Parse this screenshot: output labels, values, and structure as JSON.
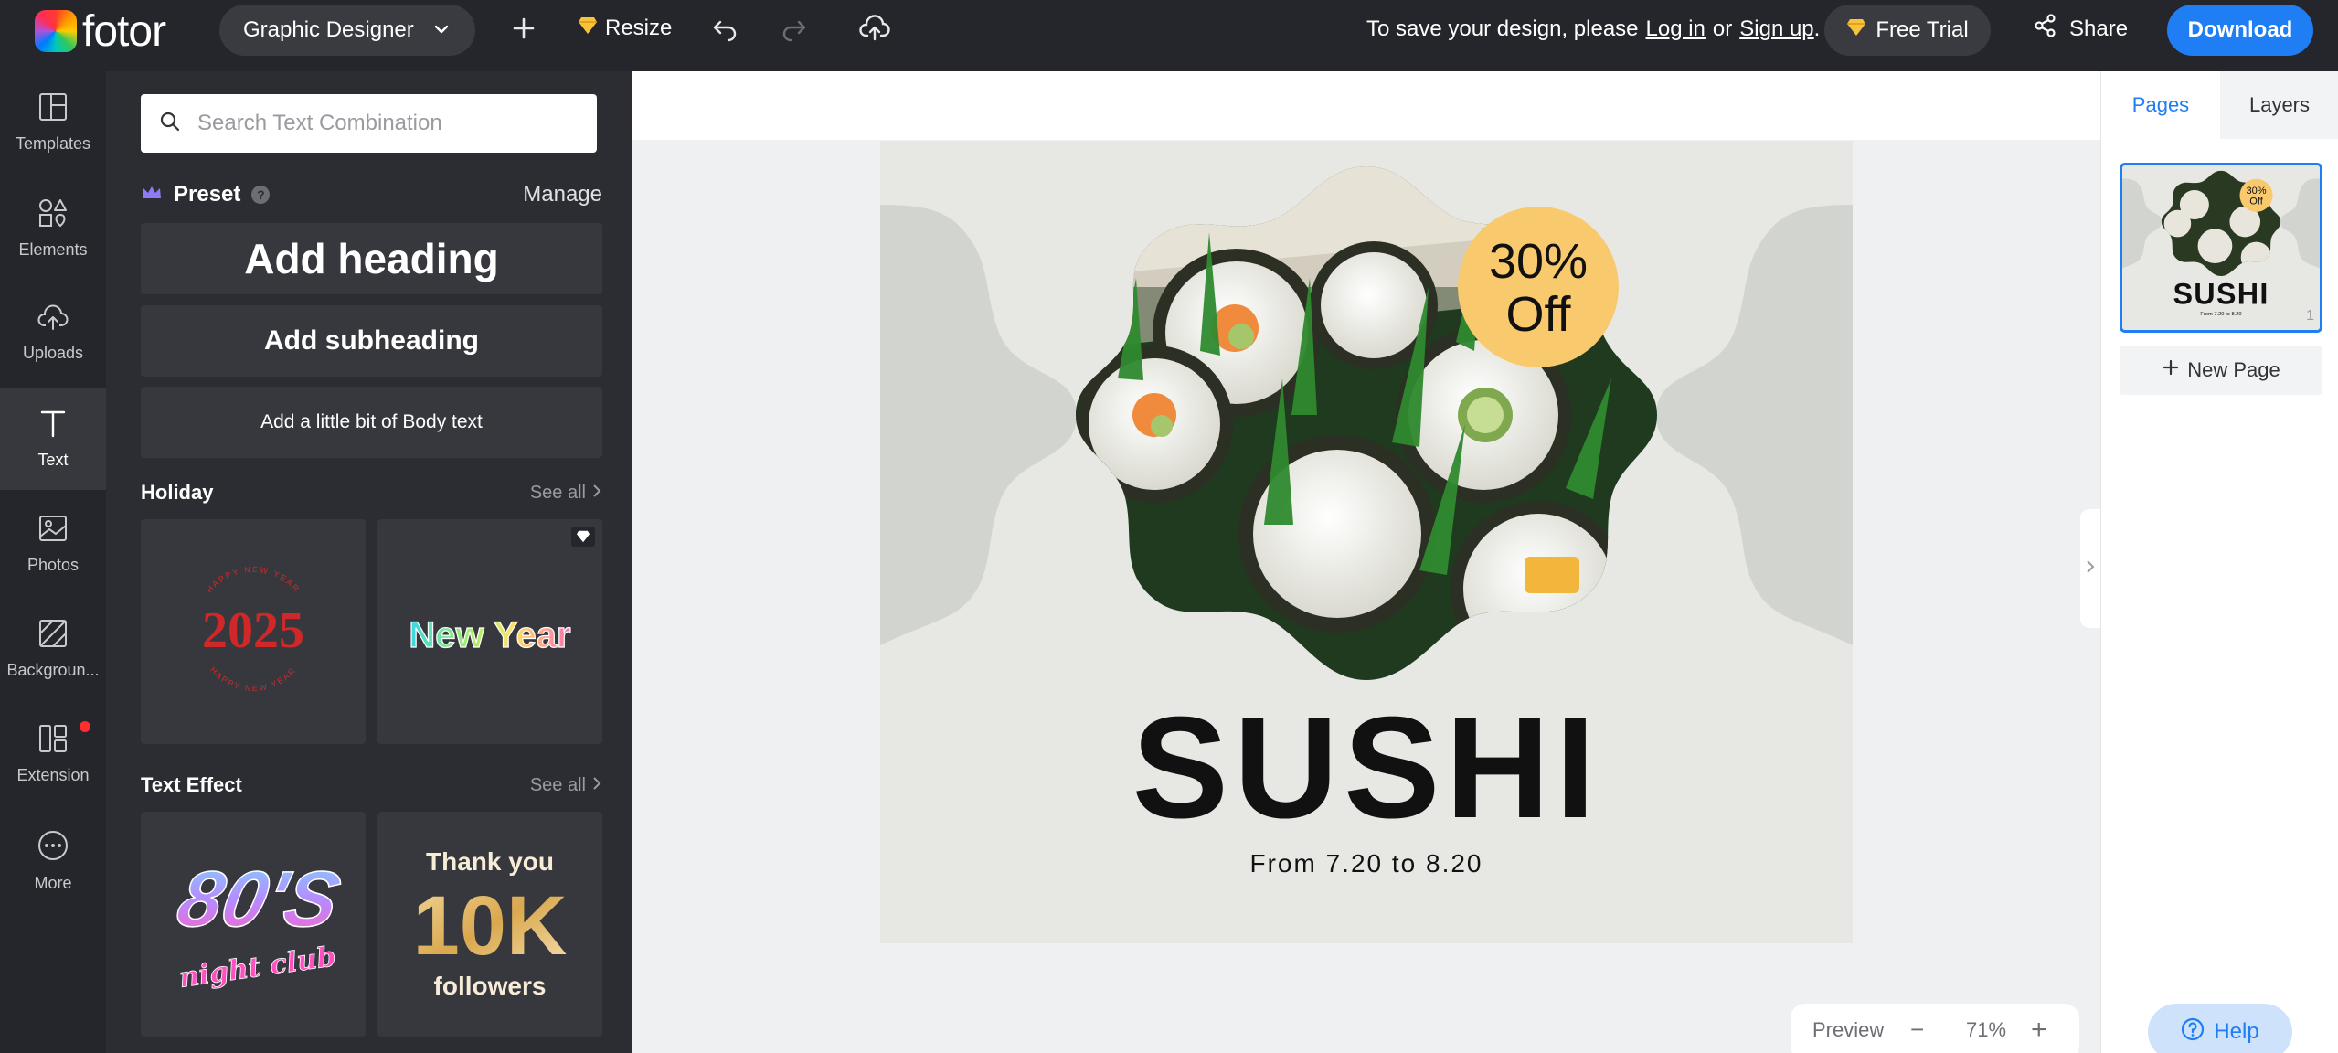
{
  "app": {
    "brand": "fotor"
  },
  "topbar": {
    "design_type": "Graphic Designer",
    "resize_label": "Resize",
    "save_prompt": "To save your design, please",
    "login_label": "Log in",
    "or_label": "or",
    "signup_label": "Sign up",
    "period": ".",
    "free_trial_label": "Free Trial",
    "share_label": "Share",
    "download_label": "Download"
  },
  "leftnav": {
    "items": [
      {
        "label": "Templates",
        "icon": "templates-icon"
      },
      {
        "label": "Elements",
        "icon": "elements-icon"
      },
      {
        "label": "Uploads",
        "icon": "uploads-icon"
      },
      {
        "label": "Text",
        "icon": "text-icon",
        "active": true
      },
      {
        "label": "Photos",
        "icon": "photos-icon"
      },
      {
        "label": "Backgroun...",
        "icon": "background-icon"
      },
      {
        "label": "Extension",
        "icon": "extension-icon",
        "badge": true
      },
      {
        "label": "More",
        "icon": "more-icon"
      }
    ]
  },
  "panel": {
    "search_placeholder": "Search Text Combination",
    "preset_title": "Preset",
    "manage_label": "Manage",
    "add_heading": "Add heading",
    "add_subheading": "Add subheading",
    "add_body": "Add a little bit of Body text",
    "holiday": {
      "title": "Holiday",
      "see_all": "See all",
      "tiles": [
        {
          "big": "2025",
          "ring": "HAPPY NEW YEAR"
        },
        {
          "text": "New Year",
          "premium": true
        }
      ]
    },
    "text_effect": {
      "title": "Text Effect",
      "see_all": "See all",
      "tiles": [
        {
          "line1": "80'S",
          "line2": "night club"
        },
        {
          "line1": "Thank you",
          "line2": "10K",
          "line3": "followers"
        }
      ]
    }
  },
  "design": {
    "badge_line1": "30%",
    "badge_line2": "Off",
    "title": "SUSHI",
    "subtitle": "From 7.20 to 8.20"
  },
  "zoom": {
    "preview_label": "Preview",
    "level": "71%",
    "minus": "−",
    "plus": "+"
  },
  "rightpanel": {
    "tab_pages": "Pages",
    "tab_layers": "Layers",
    "page_number": "1",
    "new_page_label": "New Page",
    "thumb_badge_line1": "30%",
    "thumb_badge_line2": "Off",
    "thumb_title": "SUSHI",
    "thumb_subtitle": "From 7.20 to 8.20"
  },
  "help_label": "Help",
  "colors": {
    "accent": "#1f7ef3",
    "topbar": "#25262b",
    "panel": "#2c2d32",
    "badge": "#f9c96e",
    "design_bg": "#e7e8e4",
    "shape": "#d2d4cf"
  }
}
